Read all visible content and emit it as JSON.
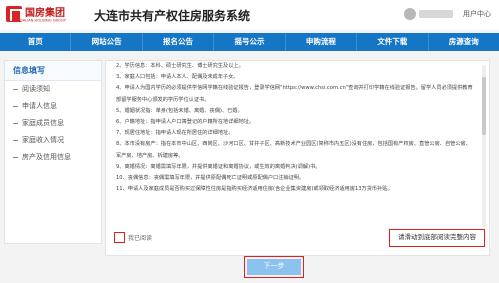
{
  "header": {
    "logo_text": "国房集团",
    "logo_sub": "DALIAN HOUSING GROUP",
    "title": "大连市共有产权住房服务系统",
    "user_center": "用户中心"
  },
  "nav": [
    "首页",
    "网站公告",
    "报名公告",
    "摇号公示",
    "申购流程",
    "文件下载",
    "房源查询"
  ],
  "sidebar": {
    "title": "信息填写",
    "items": [
      "阅读须知",
      "申请人信息",
      "家庭成员信息",
      "家庭收入情况",
      "房产及信用信息"
    ]
  },
  "content": {
    "paragraphs": [
      "2、学历信息：本科、硕士研究生、博士研究生及以上。",
      "3、家庭人口包括：申请人本人、配偶及未成年子女。",
      "4、申请人为国内学历的必须提供学信网学籍在线验证报告，登录学信网\"https://www.chsi.com.cn\"查询并打印学籍在线验证报告。留学人员必须提供教育部留学服务中心颁发的学历学位认证书。",
      "5、婚姻状况指：单身(包括未婚、离婚、丧偶)、已婚。",
      "6、户籍地址：指申请人户口簿登记的户籍所在地详细地址。",
      "7、现居住地址：指申请人现在所居住的详细地址。",
      "8、本市没有房产：指在本市中山区、西岗区、沙河口区、甘井子区、高新技术产业园区(简称市内五区)没有住房，包括国有产权房、直管公房、自管公房、军产房、地产房、拆建房等。",
      "9、离婚情况：离婚需填写年限，并提供离婚证和离婚协议，或生效的离婚判决(调解)书。",
      "10、丧偶信息：丧偶需填写年限，并提供原配偶死亡证明或原配偶户口注销证明。",
      "11、申请人及家庭成员是否购买过保障性住房是指购买经济适用住房(含企业集资建房)或领取经济适用房13万货币补贴。"
    ]
  },
  "agree_label": "我已阅读",
  "notice": "请滑动到底部阅读完整内容",
  "next_label": "下一步",
  "colors": {
    "nav_bg": "#1676c6",
    "brand_red": "#c21d1d",
    "highlight_red": "#e02020",
    "button_disabled": "#8cc2ee"
  }
}
